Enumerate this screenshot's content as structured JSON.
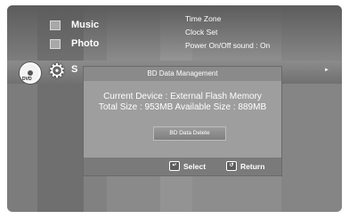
{
  "menu": {
    "items": [
      {
        "label": "Music",
        "icon": "music-icon"
      },
      {
        "label": "Photo",
        "icon": "photo-icon"
      }
    ],
    "focused_partial_label": "S",
    "disc_label": "DVD"
  },
  "settings": {
    "rows": [
      "Time Zone",
      "Clock Set",
      "Power On/Off sound :  On"
    ]
  },
  "dialog": {
    "title": "BD Data Management",
    "current_device": "Current Device : External Flash Memory",
    "sizes": "Total Size : 953MB    Available Size : 889MB",
    "delete_button": "BD Data Delete"
  },
  "footer": {
    "select_label": "Select",
    "return_label": "Return"
  },
  "focus_arrow": "►"
}
